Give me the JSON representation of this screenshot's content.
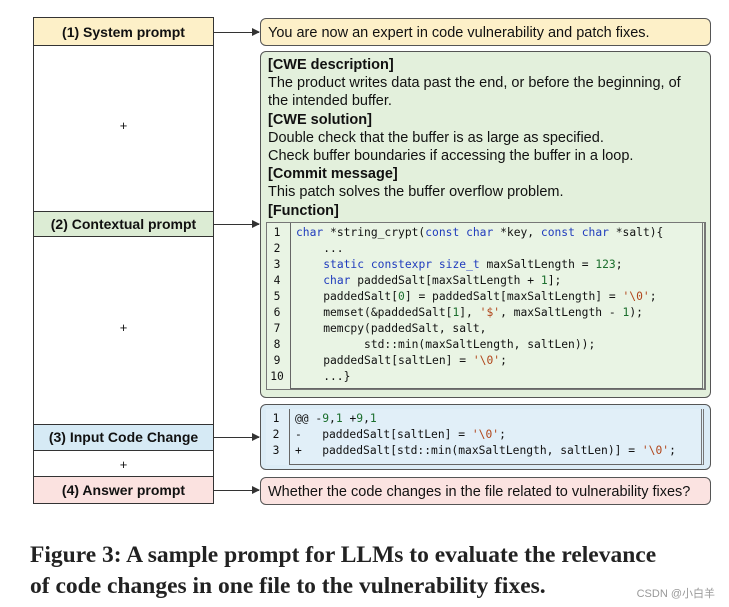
{
  "left_labels": {
    "system": "(1) System prompt",
    "context": "(2) Contextual prompt",
    "input": "(3) Input Code Change",
    "answer": "(4) Answer prompt",
    "plus": "+"
  },
  "system_prompt": "You are now an expert in code vulnerability and patch fixes.",
  "contextual": {
    "cwe_desc_head": "[CWE description]",
    "cwe_desc_1": "The product writes data past the end, or before the beginning, of",
    "cwe_desc_2": "the intended buffer.",
    "cwe_sol_head": "[CWE solution]",
    "cwe_sol_1": "Double check that the buffer is as large as specified.",
    "cwe_sol_2": "Check buffer boundaries if accessing the buffer in a loop.",
    "commit_head": "[Commit message]",
    "commit_1": "This patch solves the buffer overflow problem.",
    "function_head": "[Function]"
  },
  "function_code": {
    "line_numbers": [
      "1",
      "2",
      "3",
      "4",
      "5",
      "6",
      "7",
      "8",
      "9",
      "10"
    ],
    "lines": [
      "char *string_crypt(const char *key, const char *salt){",
      "    ...",
      "    static constexpr size_t maxSaltLength = 123;",
      "    char paddedSalt[maxSaltLength + 1];",
      "    paddedSalt[0] = paddedSalt[maxSaltLength] = '\\0';",
      "    memset(&paddedSalt[1], '$', maxSaltLength - 1);",
      "    memcpy(paddedSalt, salt,",
      "          std::min(maxSaltLength, saltLen));",
      "    paddedSalt[saltLen] = '\\0';",
      "    ...}"
    ]
  },
  "code_change": {
    "line_numbers": [
      "1",
      "2",
      "3"
    ],
    "lines": [
      "@@ -9,1 +9,1",
      "-   paddedSalt[saltLen] = '\\0';",
      "+   paddedSalt[std::min(maxSaltLength, saltLen)] = '\\0';"
    ]
  },
  "answer_prompt": "Whether the code changes in the file related to vulnerability fixes?",
  "caption_1": "Figure 3: A sample prompt for LLMs to evaluate the relevance",
  "caption_2": "of code changes in one file to the vulnerability fixes.",
  "watermark": "CSDN @小白羊",
  "colors": {
    "system": "#fdf0c8",
    "context": "#e3f0dc",
    "input": "#dcecf6",
    "answer": "#fbe3e1",
    "keyword": "#1f3bbd",
    "string": "#b0451a",
    "number": "#1a6e2c"
  }
}
